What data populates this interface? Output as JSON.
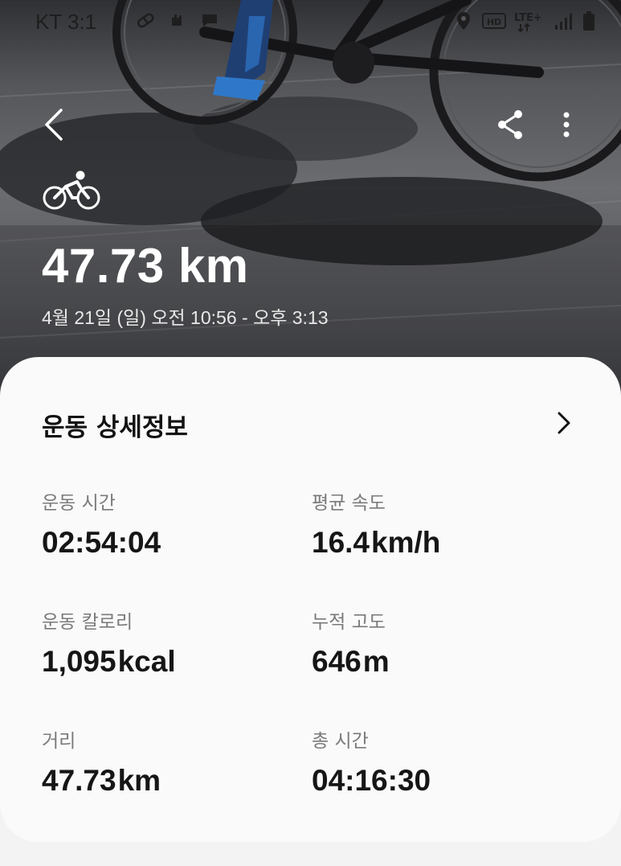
{
  "status_bar": {
    "carrier_time": "KT 3:1",
    "icons": [
      "pill-icon",
      "hand-icon",
      "chat-icon",
      "location-icon",
      "hd-icon",
      "lte-icon",
      "signal-icon",
      "battery-icon"
    ]
  },
  "header": {
    "activity_icon": "cycling-icon",
    "distance": "47.73 km",
    "datetime": "4월 21일 (일) 오전 10:56 - 오후 3:13"
  },
  "details": {
    "title": "운동 상세정보",
    "stats": [
      {
        "label": "운동 시간",
        "value": "02:54:04",
        "unit": ""
      },
      {
        "label": "평균 속도",
        "value": "16.4",
        "unit": "km/h"
      },
      {
        "label": "운동 칼로리",
        "value": "1,095",
        "unit": "kcal"
      },
      {
        "label": "누적 고도",
        "value": "646",
        "unit": "m"
      },
      {
        "label": "거리",
        "value": "47.73",
        "unit": "km"
      },
      {
        "label": "총 시간",
        "value": "04:16:30",
        "unit": ""
      }
    ]
  },
  "colors": {
    "card_bg": "#fafafa",
    "page_bg": "#f3f3f4",
    "text_primary": "#161616",
    "text_secondary": "#7a7a7a"
  }
}
